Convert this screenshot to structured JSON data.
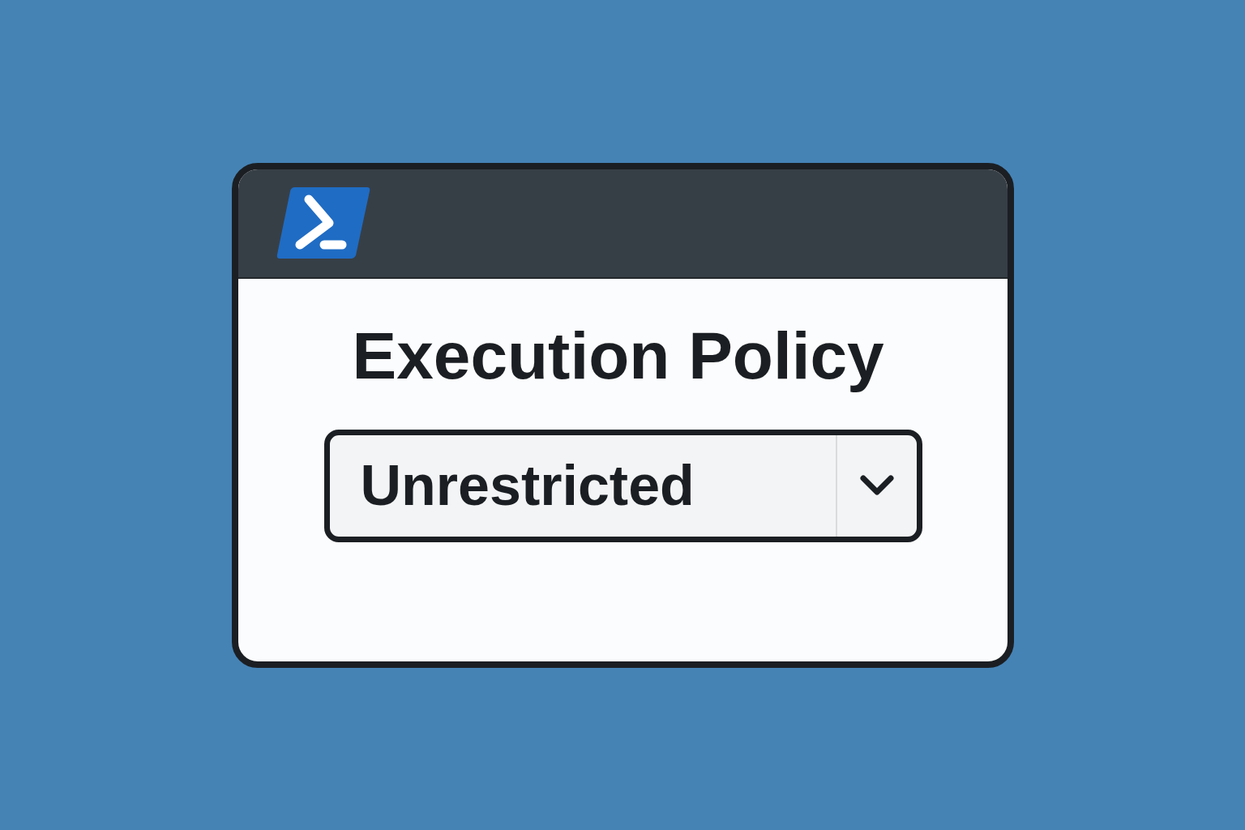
{
  "heading": "Execution Policy",
  "dropdown": {
    "value": "Unrestricted"
  }
}
